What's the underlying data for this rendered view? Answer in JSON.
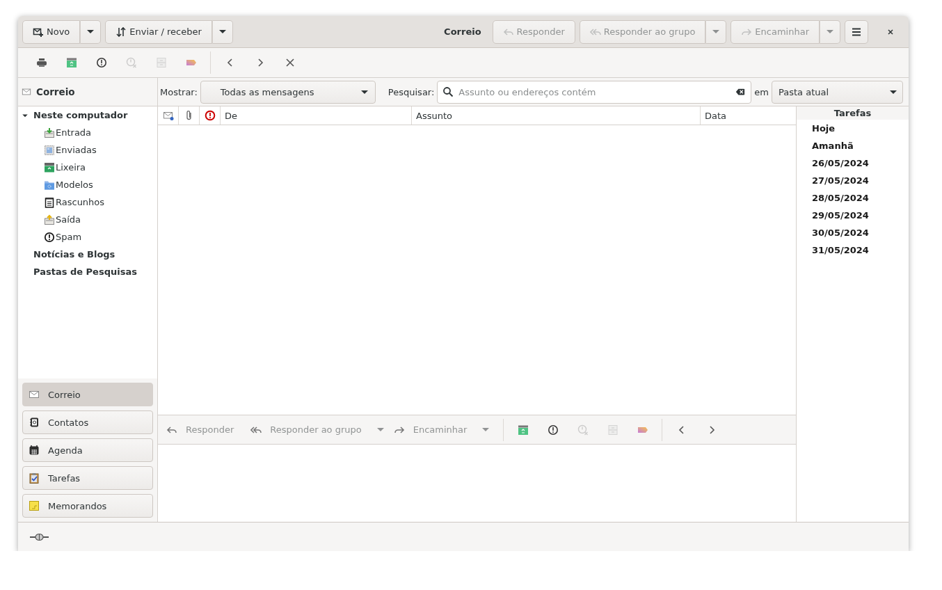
{
  "header_bar": {
    "left_buttons": [
      {
        "label": "Novo",
        "disabled": false,
        "dropdown": true
      },
      {
        "label": "Enviar / receber",
        "disabled": false,
        "dropdown": true
      }
    ],
    "title": "Correio",
    "right_buttons": [
      {
        "label": "Responder",
        "disabled": true,
        "dropdown": false
      },
      {
        "label": "Responder ao grupo",
        "disabled": true,
        "dropdown": true
      },
      {
        "label": "Encaminhar",
        "disabled": true,
        "dropdown": true
      }
    ]
  },
  "toolbar": {
    "tools": [
      {
        "disabled": false
      },
      {
        "disabled": false
      },
      {
        "disabled": false
      },
      {
        "disabled": true
      },
      {
        "disabled": true
      },
      {
        "disabled": false
      }
    ],
    "navigation": [
      {
        "disabled": false
      },
      {
        "disabled": false
      },
      {
        "disabled": false
      }
    ]
  },
  "sidebar": {
    "title": "Correio",
    "folders": [
      {
        "label": "Neste computador",
        "expanded": true,
        "children": [
          {
            "label": "Entrada"
          },
          {
            "label": "Enviadas"
          },
          {
            "label": "Lixeira"
          },
          {
            "label": "Modelos"
          },
          {
            "label": "Rascunhos"
          },
          {
            "label": "Saída"
          },
          {
            "label": "Spam"
          }
        ]
      },
      {
        "label": "Notícias e Blogs"
      },
      {
        "label": "Pastas de Pesquisas"
      }
    ],
    "switcher": [
      {
        "label": "Correio",
        "selected": true
      },
      {
        "label": "Contatos",
        "selected": false
      },
      {
        "label": "Agenda",
        "selected": false
      },
      {
        "label": "Tarefas",
        "selected": false
      },
      {
        "label": "Memorandos",
        "selected": false
      }
    ]
  },
  "filter_bar": {
    "show_label": "Mostrar:",
    "show_value": "Todas as mensagens",
    "search_label": "Pesquisar:",
    "search_placeholder": "Assunto ou endereços contém",
    "scope_label": "em",
    "scope_value": "Pasta atual"
  },
  "message_list": {
    "columns": [
      {
        "label": "De"
      },
      {
        "label": "Assunto"
      },
      {
        "label": "Data"
      }
    ]
  },
  "preview_toolbar": {
    "buttons": [
      {
        "label": "Responder",
        "disabled": true,
        "dropdown": false
      },
      {
        "label": "Responder ao grupo",
        "disabled": true,
        "dropdown": true
      },
      {
        "label": "Encaminhar",
        "disabled": true,
        "dropdown": true
      }
    ],
    "tools": [
      {
        "disabled": false
      },
      {
        "disabled": false
      },
      {
        "disabled": true
      },
      {
        "disabled": true
      },
      {
        "disabled": false
      }
    ],
    "navigation": [
      {
        "disabled": false
      },
      {
        "disabled": false
      }
    ]
  },
  "tasks": {
    "title": "Tarefas",
    "items": [
      {
        "label": "Hoje"
      },
      {
        "label": "Amanhã"
      },
      {
        "label": "26/05/2024"
      },
      {
        "label": "27/05/2024"
      },
      {
        "label": "28/05/2024"
      },
      {
        "label": "29/05/2024"
      },
      {
        "label": "30/05/2024"
      },
      {
        "label": "31/05/2024"
      }
    ]
  }
}
